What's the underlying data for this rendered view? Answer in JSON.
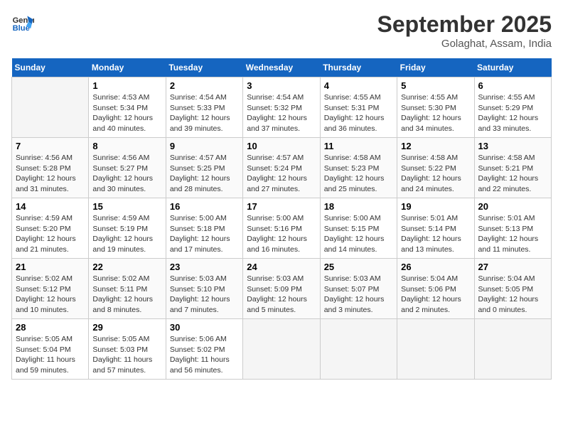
{
  "logo": {
    "line1": "General",
    "line2": "Blue"
  },
  "title": "September 2025",
  "subtitle": "Golaghat, Assam, India",
  "days_of_week": [
    "Sunday",
    "Monday",
    "Tuesday",
    "Wednesday",
    "Thursday",
    "Friday",
    "Saturday"
  ],
  "weeks": [
    [
      {
        "day": null
      },
      {
        "day": "1",
        "sunrise": "4:53 AM",
        "sunset": "5:34 PM",
        "daylight": "12 hours and 40 minutes."
      },
      {
        "day": "2",
        "sunrise": "4:54 AM",
        "sunset": "5:33 PM",
        "daylight": "12 hours and 39 minutes."
      },
      {
        "day": "3",
        "sunrise": "4:54 AM",
        "sunset": "5:32 PM",
        "daylight": "12 hours and 37 minutes."
      },
      {
        "day": "4",
        "sunrise": "4:55 AM",
        "sunset": "5:31 PM",
        "daylight": "12 hours and 36 minutes."
      },
      {
        "day": "5",
        "sunrise": "4:55 AM",
        "sunset": "5:30 PM",
        "daylight": "12 hours and 34 minutes."
      },
      {
        "day": "6",
        "sunrise": "4:55 AM",
        "sunset": "5:29 PM",
        "daylight": "12 hours and 33 minutes."
      }
    ],
    [
      {
        "day": "7",
        "sunrise": "4:56 AM",
        "sunset": "5:28 PM",
        "daylight": "12 hours and 31 minutes."
      },
      {
        "day": "8",
        "sunrise": "4:56 AM",
        "sunset": "5:27 PM",
        "daylight": "12 hours and 30 minutes."
      },
      {
        "day": "9",
        "sunrise": "4:57 AM",
        "sunset": "5:25 PM",
        "daylight": "12 hours and 28 minutes."
      },
      {
        "day": "10",
        "sunrise": "4:57 AM",
        "sunset": "5:24 PM",
        "daylight": "12 hours and 27 minutes."
      },
      {
        "day": "11",
        "sunrise": "4:58 AM",
        "sunset": "5:23 PM",
        "daylight": "12 hours and 25 minutes."
      },
      {
        "day": "12",
        "sunrise": "4:58 AM",
        "sunset": "5:22 PM",
        "daylight": "12 hours and 24 minutes."
      },
      {
        "day": "13",
        "sunrise": "4:58 AM",
        "sunset": "5:21 PM",
        "daylight": "12 hours and 22 minutes."
      }
    ],
    [
      {
        "day": "14",
        "sunrise": "4:59 AM",
        "sunset": "5:20 PM",
        "daylight": "12 hours and 21 minutes."
      },
      {
        "day": "15",
        "sunrise": "4:59 AM",
        "sunset": "5:19 PM",
        "daylight": "12 hours and 19 minutes."
      },
      {
        "day": "16",
        "sunrise": "5:00 AM",
        "sunset": "5:18 PM",
        "daylight": "12 hours and 17 minutes."
      },
      {
        "day": "17",
        "sunrise": "5:00 AM",
        "sunset": "5:16 PM",
        "daylight": "12 hours and 16 minutes."
      },
      {
        "day": "18",
        "sunrise": "5:00 AM",
        "sunset": "5:15 PM",
        "daylight": "12 hours and 14 minutes."
      },
      {
        "day": "19",
        "sunrise": "5:01 AM",
        "sunset": "5:14 PM",
        "daylight": "12 hours and 13 minutes."
      },
      {
        "day": "20",
        "sunrise": "5:01 AM",
        "sunset": "5:13 PM",
        "daylight": "12 hours and 11 minutes."
      }
    ],
    [
      {
        "day": "21",
        "sunrise": "5:02 AM",
        "sunset": "5:12 PM",
        "daylight": "12 hours and 10 minutes."
      },
      {
        "day": "22",
        "sunrise": "5:02 AM",
        "sunset": "5:11 PM",
        "daylight": "12 hours and 8 minutes."
      },
      {
        "day": "23",
        "sunrise": "5:03 AM",
        "sunset": "5:10 PM",
        "daylight": "12 hours and 7 minutes."
      },
      {
        "day": "24",
        "sunrise": "5:03 AM",
        "sunset": "5:09 PM",
        "daylight": "12 hours and 5 minutes."
      },
      {
        "day": "25",
        "sunrise": "5:03 AM",
        "sunset": "5:07 PM",
        "daylight": "12 hours and 3 minutes."
      },
      {
        "day": "26",
        "sunrise": "5:04 AM",
        "sunset": "5:06 PM",
        "daylight": "12 hours and 2 minutes."
      },
      {
        "day": "27",
        "sunrise": "5:04 AM",
        "sunset": "5:05 PM",
        "daylight": "12 hours and 0 minutes."
      }
    ],
    [
      {
        "day": "28",
        "sunrise": "5:05 AM",
        "sunset": "5:04 PM",
        "daylight": "11 hours and 59 minutes."
      },
      {
        "day": "29",
        "sunrise": "5:05 AM",
        "sunset": "5:03 PM",
        "daylight": "11 hours and 57 minutes."
      },
      {
        "day": "30",
        "sunrise": "5:06 AM",
        "sunset": "5:02 PM",
        "daylight": "11 hours and 56 minutes."
      },
      {
        "day": null
      },
      {
        "day": null
      },
      {
        "day": null
      },
      {
        "day": null
      }
    ]
  ]
}
